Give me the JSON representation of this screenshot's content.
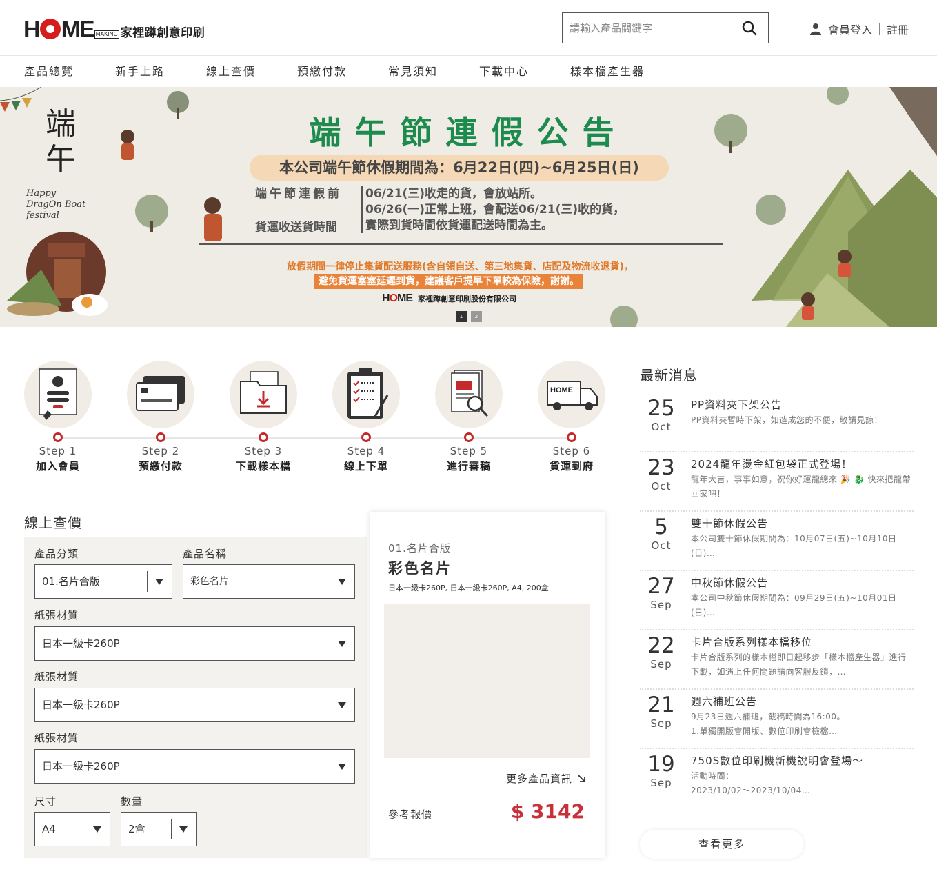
{
  "brand": {
    "logo_text": "HOME",
    "logo_making": "MAKING",
    "name_cn": "家裡蹲創意印刷"
  },
  "search": {
    "placeholder": "請輸入產品關鍵字"
  },
  "member": {
    "login": "會員登入",
    "register": "註冊"
  },
  "nav": [
    "產品總覽",
    "新手上路",
    "線上查價",
    "預繳付款",
    "常見須知",
    "下載中心",
    "樣本檔產生器"
  ],
  "banner": {
    "duanwu": "端午",
    "happy": "Happy\nDragOn Boat\nfestival",
    "title": "端午節連假公告",
    "pill": "本公司端午節休假期間為：6月22日(四)~6月25日(日)",
    "left_label_1": "端午節連假前",
    "left_label_2": "貨運收送貨時間",
    "line1": "06/21(三)收走的貨，會放站所。",
    "line2": "06/26(一)正常上班，會配送06/21(三)收的貨，",
    "line3": "實際到貨時間依貨運配送時間為主。",
    "notice1": "放假期間一律停止集貨配送服務(含自領自送、第三地集貨、店配及物流收退貨)，",
    "notice2": "避免貨運塞塞延遲到貨，建議客戶提早下單較為保險，謝謝。",
    "sign": "家裡蹲創意印刷股份有限公司",
    "dots": [
      "1",
      "2"
    ]
  },
  "steps": [
    {
      "no": "Step 1",
      "name": "加入會員",
      "icon": "member-card-icon"
    },
    {
      "no": "Step 2",
      "name": "預繳付款",
      "icon": "credit-card-icon"
    },
    {
      "no": "Step 3",
      "name": "下載樣本檔",
      "icon": "download-folder-icon"
    },
    {
      "no": "Step 4",
      "name": "線上下單",
      "icon": "clipboard-checklist-icon"
    },
    {
      "no": "Step 5",
      "name": "進行審稿",
      "icon": "document-magnifier-icon"
    },
    {
      "no": "Step 6",
      "name": "貨運到府",
      "icon": "delivery-truck-icon"
    }
  ],
  "quote": {
    "title": "線上查價",
    "category_label": "產品分類",
    "category_value": "01.名片合版",
    "product_label": "產品名稱",
    "product_value": "彩色名片",
    "paper1_label": "紙張材質",
    "paper1_value": "日本一級卡260P",
    "paper2_label": "紙張材質",
    "paper2_value": "日本一級卡260P",
    "paper3_label": "紙張材質",
    "paper3_value": "日本一級卡260P",
    "size_label": "尺寸",
    "size_value": "A4",
    "qty_label": "數量",
    "qty_value": "2盒"
  },
  "product_card": {
    "category": "01.名片合版",
    "name": "彩色名片",
    "spec": "日本一級卡260P, 日本一級卡260P, A4, 200盒",
    "more": "更多產品資訊",
    "price_label": "參考報價",
    "price": "$ 3142"
  },
  "news": {
    "title": "最新消息",
    "items": [
      {
        "day": "25",
        "mon": "Oct",
        "head": "PP資料夾下架公告",
        "desc": "PP資料夾暫時下架，如造成您的不便，敬請見諒！"
      },
      {
        "day": "23",
        "mon": "Oct",
        "head": "2024龍年燙金紅包袋正式登場！",
        "desc": "龍年大吉，事事如意，祝你好運龍總來 🎉 🐉 快來把龍帶回家吧！"
      },
      {
        "day": "5",
        "mon": "Oct",
        "head": "雙十節休假公告",
        "desc": "本公司雙十節休假期間為：10月07日(五)~10月10日(日)…"
      },
      {
        "day": "27",
        "mon": "Sep",
        "head": "中秋節休假公告",
        "desc": "本公司中秋節休假期間為：09月29日(五)~10月01日(日)…"
      },
      {
        "day": "22",
        "mon": "Sep",
        "head": "卡片合版系列樣本檔移位",
        "desc": "卡片合版系列的樣本檔即日起移步「樣本檔產生器」進行下載，如遇上任何問題請向客服反饋，…"
      },
      {
        "day": "21",
        "mon": "Sep",
        "head": "週六補班公告",
        "desc": "9月23日週六補班，截稿時間為16:00。\n1.單獨開版會開版、數位印刷會檢檔…"
      },
      {
        "day": "19",
        "mon": "Sep",
        "head": "750S數位印刷機新機說明會登場～",
        "desc": "活動時間：\n2023/10/02～2023/10/04…"
      }
    ],
    "more": "查看更多"
  },
  "colors": {
    "accent_red": "#c8303a",
    "banner_green": "#1d8a4e",
    "banner_orange": "#e9833a",
    "banner_bg": "#efece5"
  }
}
